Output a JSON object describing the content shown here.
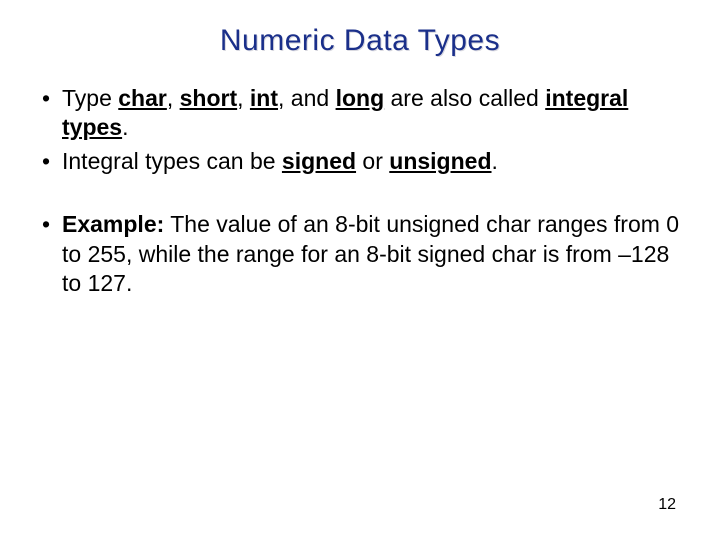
{
  "title": "Numeric Data Types",
  "bullets": {
    "b1": {
      "t1": "Type ",
      "char": "char",
      "c1": ", ",
      "short": "short",
      "c2": ", ",
      "int": "int",
      "c3": ", and ",
      "long": "long",
      "t2": " are also called ",
      "integral_types": "integral types",
      "dot": "."
    },
    "b2": {
      "t1": "Integral types can be ",
      "signed": "signed",
      "or": " or ",
      "unsigned": "unsigned",
      "dot": "."
    },
    "b3": {
      "example_label": "Example:",
      "text": " The value of an 8-bit unsigned char ranges from 0 to 255, while the range for an 8-bit signed char is from –128 to 127."
    }
  },
  "page_number": "12"
}
